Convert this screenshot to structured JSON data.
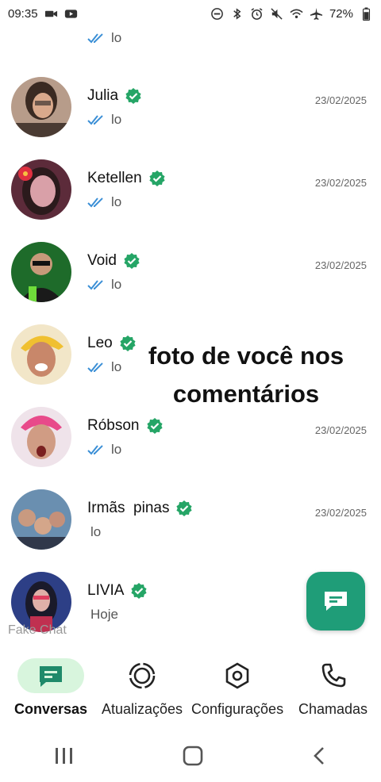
{
  "status_bar": {
    "time": "09:35",
    "battery": "72%"
  },
  "chats": [
    {
      "name": "",
      "preview": "lo",
      "date": "",
      "read_ticks": true,
      "verified": false
    },
    {
      "name": "Julia",
      "preview": "lo",
      "date": "23/02/2025",
      "read_ticks": true,
      "verified": true
    },
    {
      "name": "Ketellen",
      "preview": "lo",
      "date": "23/02/2025",
      "read_ticks": true,
      "verified": true
    },
    {
      "name": "Void",
      "preview": "lo",
      "date": "23/02/2025",
      "read_ticks": true,
      "verified": true
    },
    {
      "name": "Leo",
      "preview": "lo",
      "date": "",
      "read_ticks": true,
      "verified": true
    },
    {
      "name": "Róbson",
      "preview": "lo",
      "date": "23/02/2025",
      "read_ticks": true,
      "verified": true
    },
    {
      "name": "Irmãs  pinas",
      "preview": "lo",
      "date": "23/02/2025",
      "read_ticks": false,
      "verified": true
    },
    {
      "name": "LIVIA",
      "preview": "Hoje",
      "date": "",
      "read_ticks": false,
      "verified": true
    }
  ],
  "overlay_caption": "foto  de você  nos comentários",
  "watermark": "Fake Chat",
  "bottom_nav": [
    {
      "label": "Conversas",
      "icon": "chat-icon",
      "active": true
    },
    {
      "label": "Atualizações",
      "icon": "status-icon",
      "active": false
    },
    {
      "label": "Configurações",
      "icon": "settings-icon",
      "active": false
    },
    {
      "label": "Chamadas",
      "icon": "phone-icon",
      "active": false
    }
  ],
  "colors": {
    "accent": "#1f9d78",
    "active_nav_bg": "#d8f5dd",
    "verified": "#25a566",
    "ticks": "#3b8fd6"
  }
}
